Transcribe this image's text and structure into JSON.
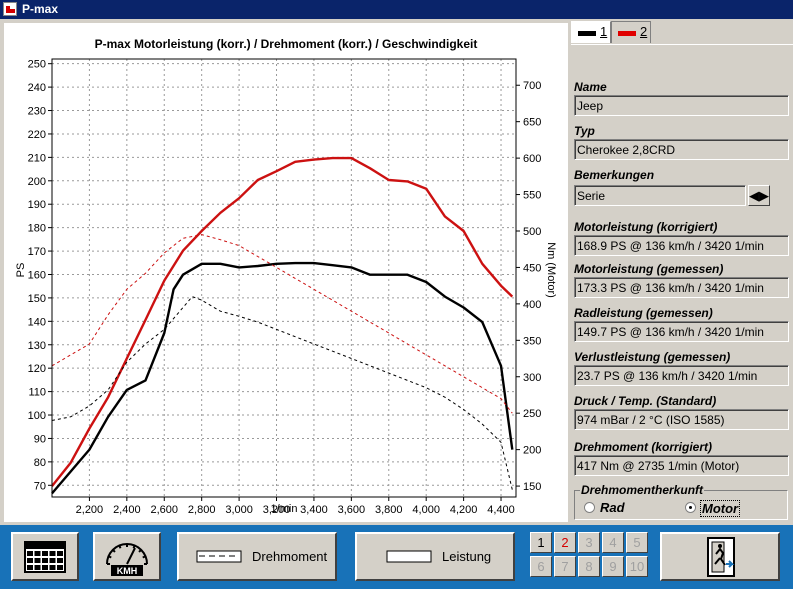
{
  "window": {
    "title": "P-max"
  },
  "chart_data": {
    "type": "line",
    "title": "P-max Motorleistung (korr.) / Drehmoment (korr.) / Geschwindigkeit",
    "xlabel": "1/min",
    "ylabel_left": "PS",
    "ylabel_right": "Nm (Motor)",
    "xlim": [
      2000,
      4480
    ],
    "ylim_left": [
      65,
      252
    ],
    "ylim_right": [
      135,
      736
    ],
    "x_ticks": [
      2200,
      2400,
      2600,
      2800,
      3000,
      3200,
      3400,
      3600,
      3800,
      4000,
      4200,
      4400
    ],
    "x_tick_labels": [
      "2,200",
      "2,400",
      "2,600",
      "2,800",
      "3,000",
      "3,200",
      "3,400",
      "3,600",
      "3,800",
      "4,000",
      "4,200",
      "4,400"
    ],
    "y_left_ticks": [
      70,
      80,
      90,
      100,
      110,
      120,
      130,
      140,
      150,
      160,
      170,
      180,
      190,
      200,
      210,
      220,
      230,
      240,
      250
    ],
    "y_right_ticks": [
      150,
      200,
      250,
      300,
      350,
      400,
      450,
      500,
      550,
      600,
      650,
      700
    ],
    "grid": true,
    "series": [
      {
        "color": "#cc1111",
        "style": "solid",
        "axis": "right",
        "x": [
          2000,
          2100,
          2200,
          2300,
          2400,
          2500,
          2600,
          2700,
          2800,
          2900,
          3000,
          3100,
          3200,
          3300,
          3400,
          3500,
          3600,
          3700,
          3800,
          3900,
          4000,
          4100,
          4200,
          4300,
          4400,
          4460
        ],
        "values": [
          150,
          182,
          229,
          272,
          325,
          378,
          432,
          473,
          500,
          525,
          545,
          570,
          582,
          595,
          598,
          600,
          600,
          586,
          570,
          568,
          558,
          520,
          500,
          455,
          425,
          410
        ]
      },
      {
        "color": "#000000",
        "style": "solid",
        "axis": "right",
        "x": [
          2000,
          2100,
          2200,
          2300,
          2400,
          2500,
          2600,
          2650,
          2700,
          2800,
          2900,
          3000,
          3100,
          3200,
          3300,
          3400,
          3500,
          3600,
          3700,
          3800,
          3900,
          4000,
          4100,
          4200,
          4300,
          4400,
          4460
        ],
        "values": [
          140,
          170,
          200,
          245,
          282,
          295,
          360,
          420,
          440,
          455,
          455,
          450,
          452,
          455,
          456,
          456,
          453,
          450,
          440,
          440,
          440,
          430,
          410,
          395,
          375,
          315,
          200
        ]
      },
      {
        "color": "#cc1111",
        "style": "dashed",
        "axis": "right",
        "x": [
          2000,
          2100,
          2200,
          2300,
          2400,
          2500,
          2600,
          2700,
          2800,
          2900,
          3000,
          3100,
          3200,
          3300,
          3400,
          3500,
          3600,
          3700,
          3800,
          3900,
          4000,
          4100,
          4200,
          4300,
          4400,
          4460
        ],
        "values": [
          315,
          330,
          345,
          385,
          420,
          442,
          470,
          490,
          495,
          488,
          480,
          465,
          450,
          435,
          420,
          405,
          390,
          375,
          360,
          345,
          330,
          315,
          300,
          285,
          270,
          250
        ]
      },
      {
        "color": "#000000",
        "style": "dashed",
        "axis": "right",
        "x": [
          2000,
          2100,
          2200,
          2300,
          2400,
          2500,
          2600,
          2700,
          2750,
          2800,
          2900,
          3000,
          3100,
          3200,
          3300,
          3400,
          3500,
          3600,
          3700,
          3800,
          3900,
          4000,
          4100,
          4200,
          4300,
          4400,
          4460
        ],
        "values": [
          240,
          245,
          260,
          282,
          320,
          345,
          365,
          395,
          410,
          405,
          390,
          383,
          375,
          365,
          355,
          345,
          335,
          325,
          315,
          305,
          295,
          285,
          272,
          255,
          235,
          210,
          145
        ]
      }
    ]
  },
  "tabs": [
    {
      "label": "1",
      "color": "#000000"
    },
    {
      "label": "2",
      "color": "#e00000"
    }
  ],
  "fields": {
    "name_label": "Name",
    "name_value": "Jeep",
    "typ_label": "Typ",
    "typ_value": "Cherokee 2,8CRD",
    "bem_label": "Bemerkungen",
    "bem_value": "Serie",
    "ml_korr_label": "Motorleistung (korrigiert)",
    "ml_korr_value": "168.9 PS @ 136 km/h / 3420 1/min",
    "ml_gem_label": "Motorleistung (gemessen)",
    "ml_gem_value": "173.3 PS @ 136 km/h / 3420 1/min",
    "rad_label": "Radleistung (gemessen)",
    "rad_value": "149.7 PS @ 136 km/h / 3420 1/min",
    "verl_label": "Verlustleistung (gemessen)",
    "verl_value": "23.7 PS @ 136 km/h / 3420 1/min",
    "druck_label": "Druck / Temp. (Standard)",
    "druck_value": "974 mBar / 2 °C (ISO 1585)",
    "dm_label": "Drehmoment (korrigiert)",
    "dm_value": "417 Nm @ 2735 1/min (Motor)"
  },
  "drehmoment_herkunft": {
    "legend": "Drehmomentherkunft",
    "option_rad": "Rad",
    "option_motor": "Motor",
    "selected": "Motor"
  },
  "toolbar": {
    "speed_label": "KMH",
    "torque_label": "Drehmoment",
    "power_label": "Leistung",
    "slots": [
      "1",
      "2",
      "3",
      "4",
      "5",
      "6",
      "7",
      "8",
      "9",
      "10"
    ]
  }
}
